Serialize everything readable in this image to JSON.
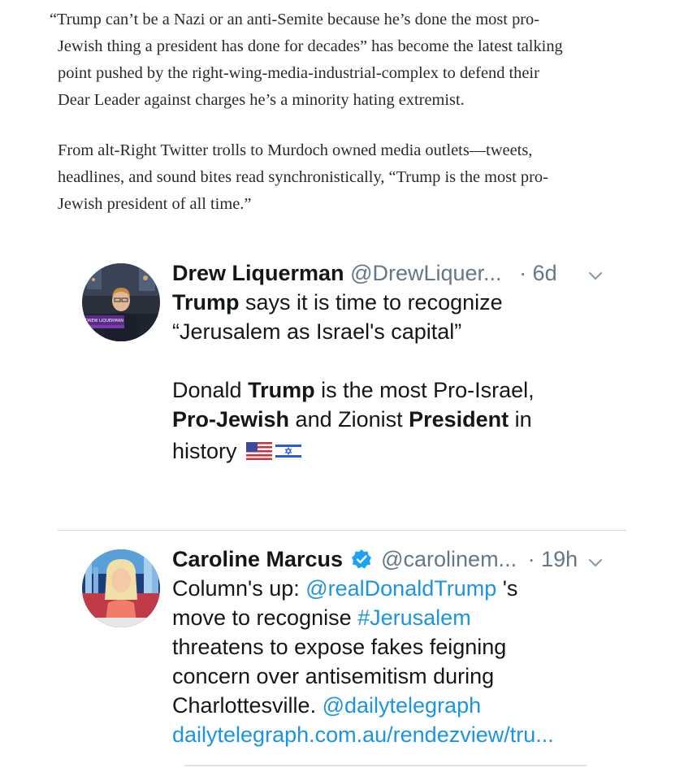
{
  "article": {
    "paragraph_1": [
      "“Trump can’t be a Nazi or an anti-Semite because he’s done the most pro-",
      "Jewish thing a president has done for decades” has become the latest talking",
      "point pushed by the right-wing-media-industrial-complex to defend their",
      "Dear Leader against charges he’s a minority hating extremist."
    ],
    "paragraph_2": [
      "From alt-Right Twitter trolls to Murdoch owned media outlets—tweets,",
      "headlines, and sound bites read synchronistically, “Trump is the most pro-",
      "Jewish president of all time.”"
    ]
  },
  "tweets": [
    {
      "name": "Drew Liquerman",
      "handle": "@DrewLiquer...",
      "time": "· 6d",
      "avatar_caption": "DREW LIQUERMAN",
      "text": {
        "l1_bold": "Trump",
        "l1_rest": " says it is time to recognize",
        "l2": "“Jerusalem as Israel's capital”",
        "l3_a": "Donald ",
        "l3_bold": "Trump",
        "l3_b": " is the most Pro-Israel,",
        "l4_bold1": "Pro-Jewish",
        "l4_a": " and Zionist ",
        "l4_bold2": "President",
        "l4_b": " in",
        "l5": "history"
      },
      "flags": [
        "us-flag-icon",
        "israel-flag-icon"
      ]
    },
    {
      "name": "Caroline Marcus",
      "handle": "@carolinem...",
      "time": "· 19h",
      "verified": true,
      "text": {
        "l1_a": "Column's up: ",
        "l1_link": "@realDonaldTrump",
        "l1_b": " 's",
        "l2_a": "move to recognise ",
        "l2_link": "#Jerusalem",
        "l3": "threatens to expose fakes feigning",
        "l4": "concern over antisemitism during",
        "l5_a": "Charlottesville. ",
        "l5_link": "@dailytelegraph",
        "l6_link": "dailytelegraph.com.au/rendezview/tru..."
      }
    }
  ],
  "colors": {
    "link": "#1b95e0",
    "muted": "#657786",
    "verified": "#1da1f2"
  }
}
